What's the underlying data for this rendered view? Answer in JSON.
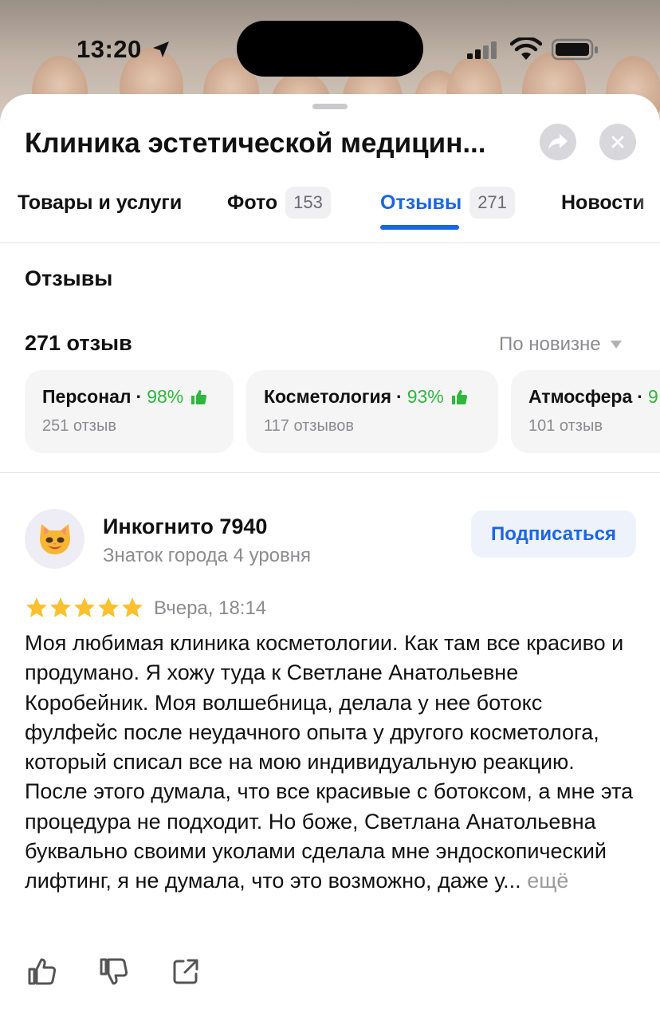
{
  "status_bar": {
    "time": "13:20"
  },
  "header": {
    "title": "Клиника эстетической медицин..."
  },
  "tabs": [
    {
      "label": "Товары и услуги",
      "count": ""
    },
    {
      "label": "Фото",
      "count": "153"
    },
    {
      "label": "Отзывы",
      "count": "271"
    },
    {
      "label": "Новости",
      "count": ""
    }
  ],
  "reviews_section": {
    "title": "Отзывы",
    "total": "271 отзыв",
    "sort_label": "По новизне",
    "aspects": [
      {
        "name": "Персонал",
        "percent": "98%",
        "count": "251 отзыв"
      },
      {
        "name": "Косметология",
        "percent": "93%",
        "count": "117 отзывов"
      },
      {
        "name": "Атмосфера",
        "percent": "9",
        "count": "101 отзыв"
      }
    ]
  },
  "review": {
    "author": "Инкогнито 7940",
    "level": "Знаток города 4 уровня",
    "subscribe_label": "Подписаться",
    "rating": 5,
    "date": "Вчера, 18:14",
    "text": "Моя любимая клиника косметологии. Как там все красиво и продумано. Я хожу туда к Светлане Анатольевне Коробейник. Моя волшебница, делала у нее ботокс фулфейс после неудачного опыта у другого косметолога, который списал все на мою индивидуальную реакцию. После этого думала, что все красивые с ботоксом, а мне эта процедура не подходит. Но боже, Светлана Анатольевна буквально своими уколами сделала мне эндоскопический лифтинг, я не думала, что это возможно, даже у...",
    "more_label": "ещё"
  },
  "colors": {
    "accent": "#1a66e5",
    "positive": "#2db83d",
    "star": "#fbc02d",
    "muted": "#8b8b90"
  },
  "icons": [
    "location-arrow-icon",
    "signal-icon",
    "wifi-icon",
    "battery-icon",
    "share-icon",
    "close-icon",
    "thumbs-up-icon",
    "cat-avatar-icon",
    "star-icon",
    "like-icon",
    "dislike-icon",
    "share-external-icon",
    "sort-caret-icon"
  ]
}
